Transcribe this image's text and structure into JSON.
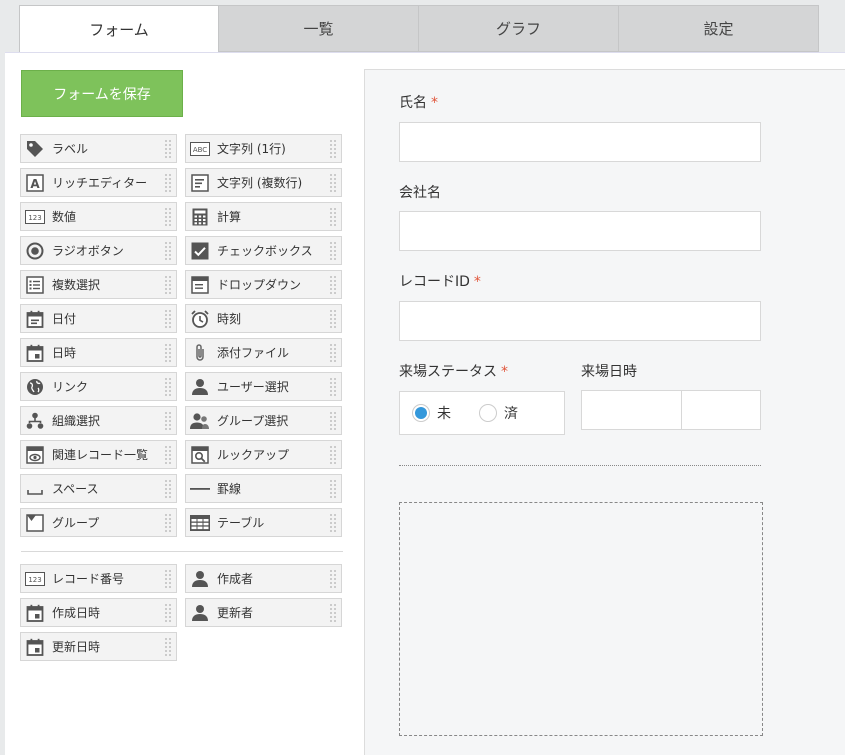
{
  "tabs": [
    {
      "label": "フォーム",
      "active": true
    },
    {
      "label": "一覧",
      "active": false
    },
    {
      "label": "グラフ",
      "active": false
    },
    {
      "label": "設定",
      "active": false
    }
  ],
  "save_button": {
    "label": "フォームを保存",
    "color": "#7ec25b"
  },
  "palette": {
    "fields": [
      {
        "label": "ラベル",
        "icon": "tag-icon"
      },
      {
        "label": "文字列 (1行)",
        "icon": "abc-text-icon"
      },
      {
        "label": "リッチエディター",
        "icon": "rich-text-icon"
      },
      {
        "label": "文字列 (複数行)",
        "icon": "multiline-text-icon"
      },
      {
        "label": "数値",
        "icon": "number-icon"
      },
      {
        "label": "計算",
        "icon": "calculator-icon"
      },
      {
        "label": "ラジオボタン",
        "icon": "radio-icon"
      },
      {
        "label": "チェックボックス",
        "icon": "checkbox-icon"
      },
      {
        "label": "複数選択",
        "icon": "multi-select-icon"
      },
      {
        "label": "ドロップダウン",
        "icon": "dropdown-icon"
      },
      {
        "label": "日付",
        "icon": "date-icon"
      },
      {
        "label": "時刻",
        "icon": "clock-icon"
      },
      {
        "label": "日時",
        "icon": "datetime-icon"
      },
      {
        "label": "添付ファイル",
        "icon": "paperclip-icon"
      },
      {
        "label": "リンク",
        "icon": "globe-icon"
      },
      {
        "label": "ユーザー選択",
        "icon": "user-icon"
      },
      {
        "label": "組織選択",
        "icon": "org-icon"
      },
      {
        "label": "グループ選択",
        "icon": "group-icon"
      },
      {
        "label": "関連レコード一覧",
        "icon": "related-records-icon"
      },
      {
        "label": "ルックアップ",
        "icon": "lookup-icon"
      },
      {
        "label": "スペース",
        "icon": "space-icon"
      },
      {
        "label": "罫線",
        "icon": "line-icon"
      },
      {
        "label": "グループ",
        "icon": "group-box-icon"
      },
      {
        "label": "テーブル",
        "icon": "table-icon"
      }
    ],
    "system_fields": [
      {
        "label": "レコード番号",
        "icon": "number-icon"
      },
      {
        "label": "作成者",
        "icon": "user-icon"
      },
      {
        "label": "作成日時",
        "icon": "datetime-icon"
      },
      {
        "label": "更新者",
        "icon": "user-icon"
      },
      {
        "label": "更新日時",
        "icon": "datetime-icon"
      }
    ]
  },
  "form": {
    "name_label": "氏名",
    "company_label": "会社名",
    "record_id_label": "レコードID",
    "status_label": "来場ステータス",
    "status_options": [
      "未",
      "済"
    ],
    "status_selected": "未",
    "visit_datetime_label": "来場日時",
    "required_mark": "*"
  }
}
